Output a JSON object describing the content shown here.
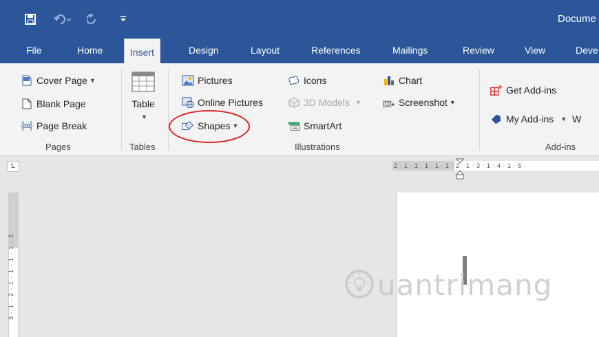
{
  "window": {
    "title": "Docume"
  },
  "quick_access": {
    "save_icon": "save-icon",
    "undo_icon": "undo-icon",
    "redo_icon": "redo-icon",
    "customize_icon": "customize-icon"
  },
  "tabs": [
    {
      "label": "File"
    },
    {
      "label": "Home"
    },
    {
      "label": "Insert"
    },
    {
      "label": "Design"
    },
    {
      "label": "Layout"
    },
    {
      "label": "References"
    },
    {
      "label": "Mailings"
    },
    {
      "label": "Review"
    },
    {
      "label": "View"
    },
    {
      "label": "Deve"
    }
  ],
  "ribbon": {
    "pages": {
      "label": "Pages",
      "cover_page": "Cover Page",
      "blank_page": "Blank Page",
      "page_break": "Page Break"
    },
    "tables": {
      "label": "Tables",
      "table": "Table"
    },
    "illustrations": {
      "label": "Illustrations",
      "pictures": "Pictures",
      "online_pictures": "Online Pictures",
      "shapes": "Shapes",
      "icons": "Icons",
      "models_3d": "3D Models",
      "smartart": "SmartArt",
      "chart": "Chart",
      "screenshot": "Screenshot"
    },
    "addins": {
      "label": "Add-ins",
      "get_addins": "Get Add-ins",
      "my_addins": "My Add-ins",
      "overflow": "W"
    }
  },
  "ruler": {
    "tab_selector": "L",
    "horizontal": "2 · 1 · 1 · 1 · 1 · 1 · 2 · 1 · 3 · 1 · 4 · 1 · 5 ·",
    "vertical": "3 · 1 · 2 · 1 · 1 · 1 · 1 · 2"
  },
  "watermark": {
    "text": "uantrimang"
  },
  "colors": {
    "accent": "#2b579a",
    "highlight": "#e02020"
  }
}
